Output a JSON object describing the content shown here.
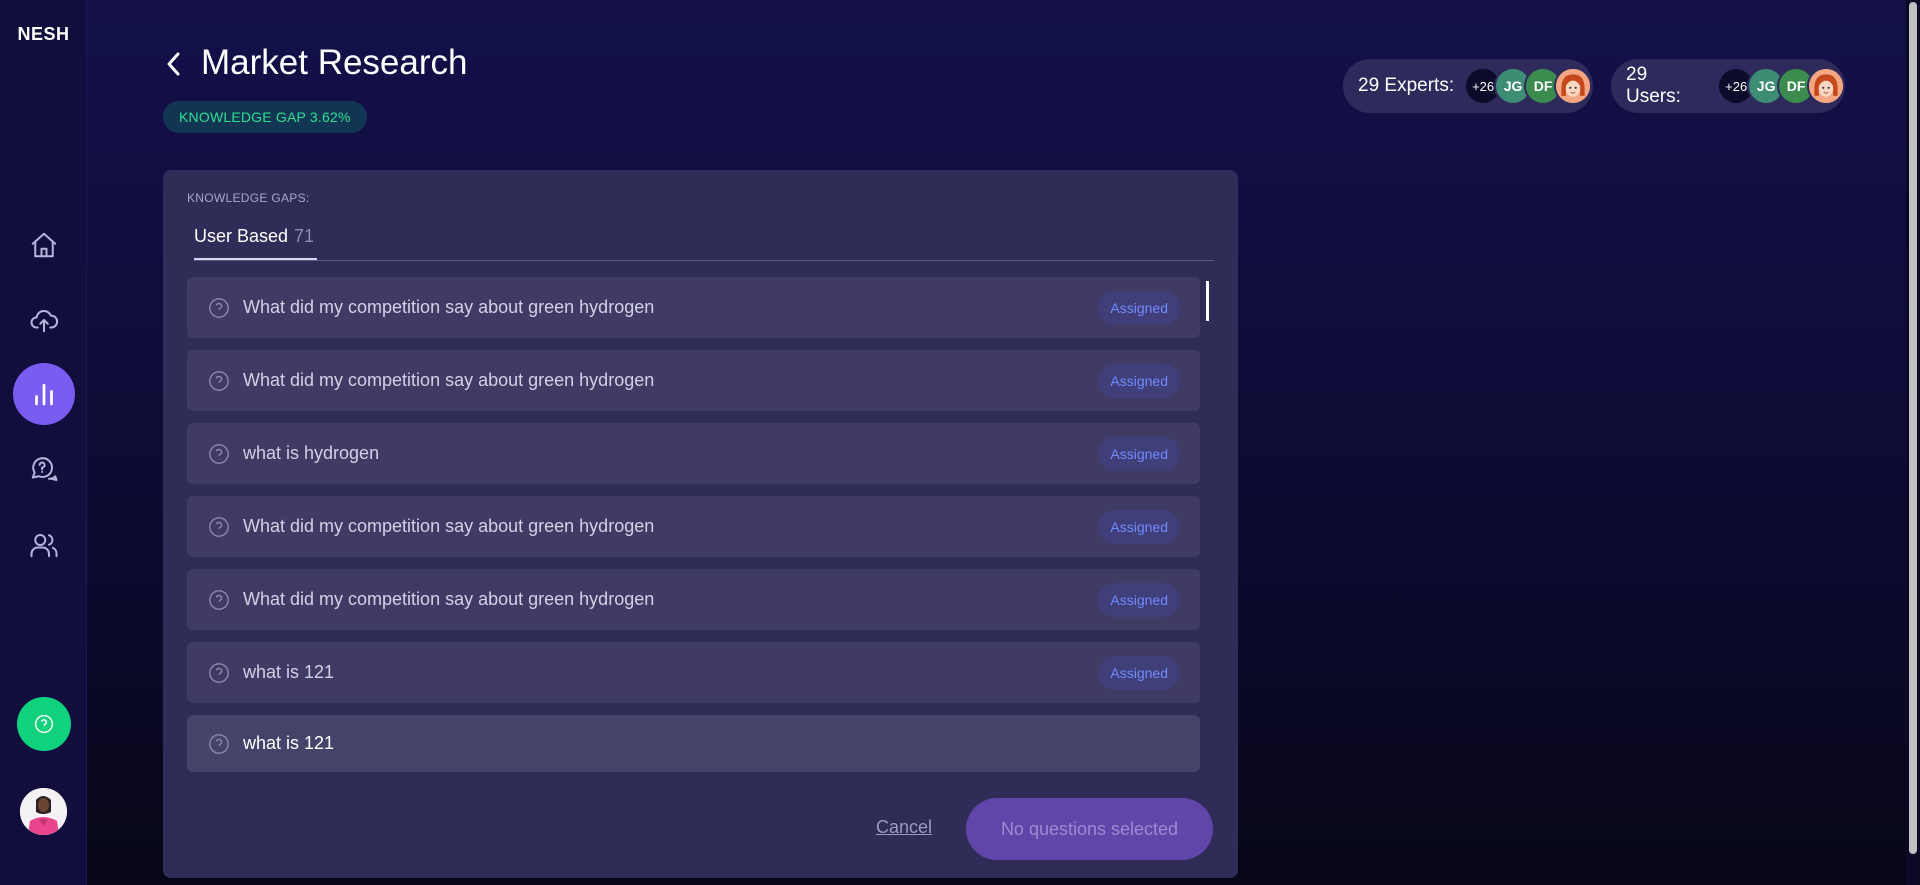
{
  "app": {
    "logo": "NESH"
  },
  "sidebar": {
    "items": [
      {
        "name": "home",
        "icon": "home-icon"
      },
      {
        "name": "upload",
        "icon": "cloud-upload-icon"
      },
      {
        "name": "analytics",
        "icon": "bar-chart-icon",
        "active": true
      },
      {
        "name": "questions",
        "icon": "chat-question-icon"
      },
      {
        "name": "users",
        "icon": "users-icon"
      }
    ],
    "help_icon": "help-circle-icon",
    "accent_color": "#7b5cf0",
    "help_color": "#10d27d"
  },
  "header": {
    "title": "Market Research",
    "knowledge_gap": "KNOWLEDGE GAP 3.62%"
  },
  "experts": {
    "label": "29 Experts:",
    "more": "+26",
    "initials": [
      "JG",
      "DF"
    ]
  },
  "users": {
    "label": "29 Users:",
    "more": "+26",
    "initials": [
      "JG",
      "DF"
    ]
  },
  "panel": {
    "section_label": "KNOWLEDGE GAPS:",
    "tab": {
      "label": "User Based",
      "count": "71"
    },
    "questions": [
      {
        "text": "What did my competition say about green hydrogen",
        "status": "Assigned"
      },
      {
        "text": "What did my competition say about green hydrogen",
        "status": "Assigned"
      },
      {
        "text": "what is hydrogen",
        "status": "Assigned"
      },
      {
        "text": "What did my competition say about green hydrogen",
        "status": "Assigned"
      },
      {
        "text": "What did my competition say about green hydrogen",
        "status": "Assigned"
      },
      {
        "text": "what is 121",
        "status": "Assigned"
      },
      {
        "text": "what is 121",
        "status": ""
      }
    ],
    "cancel_label": "Cancel",
    "submit_label": "No questions selected"
  }
}
